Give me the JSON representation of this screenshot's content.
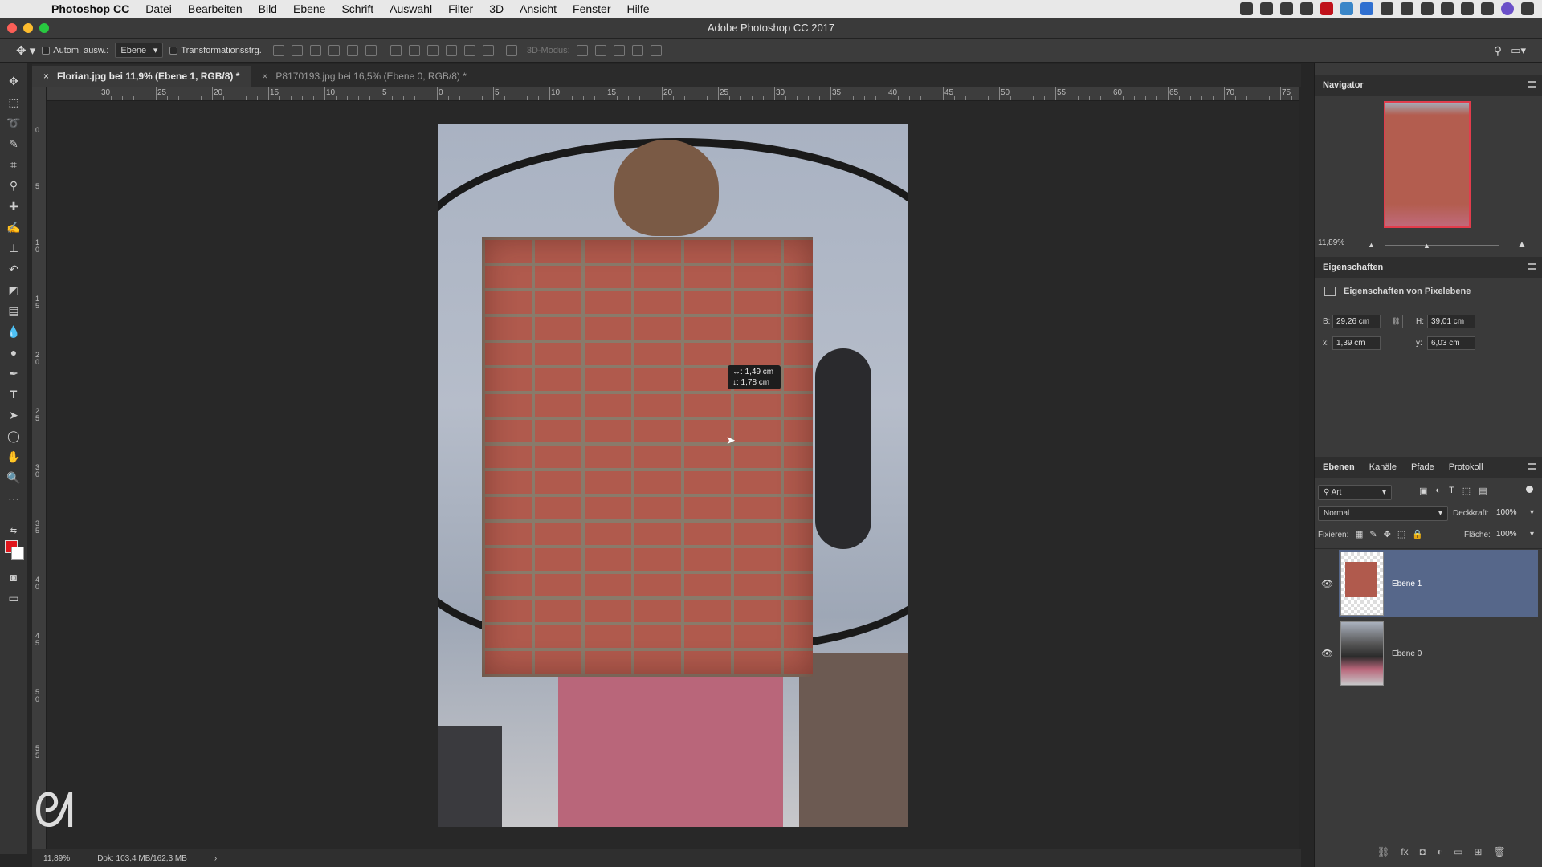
{
  "menubar": {
    "app": "Photoshop CC",
    "items": [
      "Datei",
      "Bearbeiten",
      "Bild",
      "Ebene",
      "Schrift",
      "Auswahl",
      "Filter",
      "3D",
      "Ansicht",
      "Fenster",
      "Hilfe"
    ]
  },
  "window": {
    "title": "Adobe Photoshop CC 2017"
  },
  "options": {
    "auto_select_label": "Autom. ausw.:",
    "auto_select_value": "Ebene",
    "transform_label": "Transformationsstrg.",
    "mode3d": "3D-Modus:"
  },
  "tabs": [
    {
      "label": "Florian.jpg bei 11,9% (Ebene 1, RGB/8) *",
      "close": "×",
      "active": true
    },
    {
      "label": "P8170193.jpg bei 16,5% (Ebene 0, RGB/8) *",
      "close": "×",
      "active": false
    }
  ],
  "ruler_h": [
    "30",
    "25",
    "20",
    "15",
    "10",
    "5",
    "0",
    "5",
    "10",
    "15",
    "20",
    "25",
    "30",
    "35",
    "40",
    "45",
    "50",
    "55",
    "60",
    "65",
    "70",
    "75"
  ],
  "ruler_v": [
    "0",
    "5",
    "1 0",
    "1 5",
    "2 0",
    "2 5",
    "3 0",
    "3 5",
    "4 0",
    "4 5",
    "5 0",
    "5 5"
  ],
  "tooltip": {
    "line1": "↔: 1,49 cm",
    "line2": "↕: 1,78 cm"
  },
  "status": {
    "zoom": "11,89%",
    "doc": "Dok: 103,4 MB/162,3 MB",
    "arrow": "›"
  },
  "navigator": {
    "title": "Navigator",
    "zoom": "11,89%"
  },
  "properties": {
    "title": "Eigenschaften",
    "subtitle": "Eigenschaften von Pixelebene",
    "b_label": "B:",
    "b_value": "29,26 cm",
    "h_label": "H:",
    "h_value": "39,01 cm",
    "x_label": "x:",
    "x_value": "1,39 cm",
    "y_label": "y:",
    "y_value": "6,03 cm"
  },
  "layers_panel": {
    "tabs": [
      "Ebenen",
      "Kanäle",
      "Pfade",
      "Protokoll"
    ],
    "filter": "Art",
    "blend_mode": "Normal",
    "opacity_label": "Deckkraft:",
    "opacity_value": "100%",
    "lock_label": "Fixieren:",
    "fill_label": "Fläche:",
    "fill_value": "100%",
    "layers": [
      {
        "name": "Ebene 1",
        "selected": true
      },
      {
        "name": "Ebene 0",
        "selected": false
      }
    ]
  },
  "colors": {
    "accent_selected_layer": "#56678a",
    "foreground": "#e0161c",
    "background": "#ffffff"
  }
}
